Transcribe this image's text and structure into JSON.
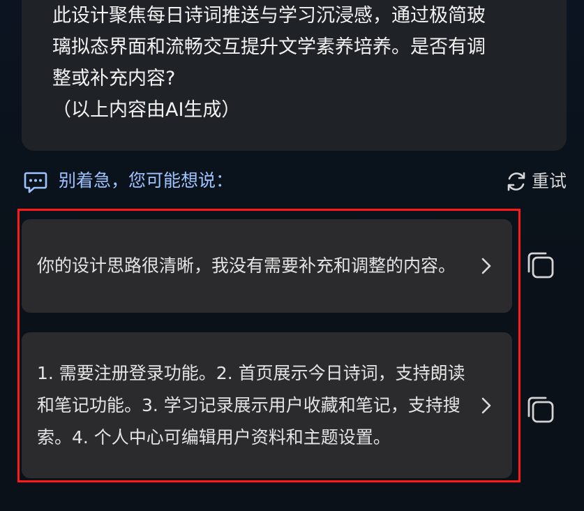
{
  "ai_message": {
    "lines": [
      "此设计聚焦每日诗词推送与学习沉浸感，通过极简玻",
      "璃拟态界面和流畅交互提升文学素养培养。是否有调",
      "整或补充内容?",
      "（以上内容由AI生成）"
    ]
  },
  "suggestions": {
    "header_label": "别着急，您可能想说：",
    "retry_label": "重试",
    "items": [
      {
        "text": "你的设计思路很清晰，我没有需要补充和调整的内容。"
      },
      {
        "text": "1. 需要注册登录功能。2. 首页展示今日诗词，支持朗读和笔记功能。3. 学习记录展示用户收藏和笔记，支持搜索。4. 个人中心可编辑用户资料和主题设置。"
      }
    ]
  },
  "icons": {
    "suggest": "chat-bubble-icon",
    "retry": "refresh-icon",
    "chevron": "chevron-right-icon",
    "copy": "copy-icon"
  },
  "colors": {
    "accent": "#9fc3ff",
    "highlight": "#ff1a1a",
    "card": "#2b2b2d",
    "bubble": "#1f2226"
  }
}
